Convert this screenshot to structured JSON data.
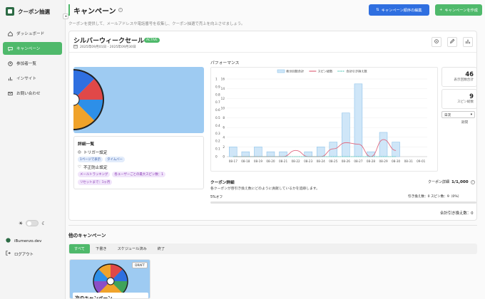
{
  "app": {
    "name": "クーポン抽選"
  },
  "sidebar": {
    "items": [
      {
        "label": "ダッシュボード",
        "icon": "dashboard-icon",
        "active": false
      },
      {
        "label": "キャンペーン",
        "icon": "chat-icon",
        "active": true
      },
      {
        "label": "参加者一覧",
        "icon": "users-icon",
        "active": false
      },
      {
        "label": "インサイト",
        "icon": "bar-chart-icon",
        "active": false
      },
      {
        "label": "お問い合わせ",
        "icon": "mail-icon",
        "active": false
      }
    ],
    "user": "iBumenzo.dev",
    "logout": "ログアウト"
  },
  "header": {
    "title": "キャンペーン",
    "subtitle": "クーポンを提供して、メールアドレスや電話番号を収集し、クーポン抽選で売上を向上させましょう。",
    "edit_button": "キャンペーン順序の編集",
    "create_button": "キャンペーンを作成"
  },
  "campaign": {
    "name": "シルバーウィークセール",
    "status": "ACTIVE",
    "dates": "2025年09月01日 - 2025年09月30日",
    "details": {
      "title": "詳細一覧",
      "trigger_label": "トリガー設定",
      "triggers": [
        "1ページで表示",
        "タイムバー"
      ],
      "fraud_label": "不正防止設定",
      "fraud": [
        "メールトラッキング",
        "各ユーザーごとの最大スピン数：1",
        "リセットまで：1ヶ月"
      ]
    },
    "performance_title": "パフォーマンス",
    "stats": {
      "impressions_value": "46",
      "impressions_label": "表示回数合計",
      "spins_value": "9",
      "spins_label": "スピン総数"
    },
    "period": {
      "selected": "日次",
      "label": "期間"
    },
    "coupon": {
      "section_title": "クーポン詳細",
      "description": "各クーポンが啓引き換え数にどのように貢献しているかを追跡します。",
      "count_label": "クーポン詳細",
      "count_value": "1/1,000",
      "item_name": "5%オフ",
      "item_stat": "引き換え数：0 スピン数：9（0%）",
      "progress": 0,
      "total": "合計引き換え数：0"
    }
  },
  "chart_data": {
    "type": "bar",
    "categories": [
      "08-17",
      "08-18",
      "08-19",
      "08-20",
      "08-21",
      "08-22",
      "08-23",
      "08-24",
      "08-25",
      "08-26",
      "08-27",
      "08-28",
      "08-29",
      "08-30",
      "08-31",
      "09-01"
    ],
    "series": [
      {
        "name": "表示回数合計",
        "kind": "bar",
        "axis": "left",
        "color": "#8fc3ea",
        "values": [
          2,
          1,
          2,
          1,
          1,
          0,
          1,
          2,
          3,
          9,
          15,
          1,
          5,
          3
        ]
      },
      {
        "name": "スピン総数",
        "kind": "line",
        "axis": "right",
        "color": "#e0697f",
        "values": [
          0,
          0,
          0,
          0,
          0,
          0.08,
          0,
          0,
          0.1,
          0.18,
          0.16,
          0,
          0.22,
          0.08
        ]
      },
      {
        "name": "合計引き換え数",
        "kind": "line",
        "axis": "right",
        "color": "#52c7b8",
        "values": [
          0,
          0,
          0,
          0,
          0,
          0,
          0,
          0,
          0,
          0,
          0,
          0,
          0,
          0
        ]
      }
    ],
    "ylim_left": [
      0,
      16
    ],
    "yticks_left": [
      0,
      2,
      4,
      6,
      8,
      10,
      12,
      14,
      16
    ],
    "ylim_right": [
      0,
      1
    ],
    "yticks_right": [
      0,
      0.1,
      0.2,
      0.3,
      0.4,
      0.5,
      0.6,
      0.7,
      0.8,
      0.9,
      1
    ],
    "legend": "top-center"
  },
  "other": {
    "title": "他のキャンペーン",
    "tabs": [
      "すべて",
      "下書き",
      "スケジュール済み",
      "終了"
    ],
    "draft_badge": "DRAFT",
    "draft_name": "次のキャンペーン"
  }
}
